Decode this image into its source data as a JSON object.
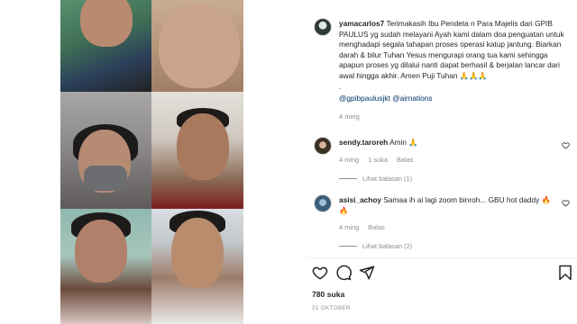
{
  "post": {
    "username": "yamacarlos7",
    "caption": "Terimakasih Ibu Pendeta n Para Majelis dari GPIB PAULUS yg sudah melayani Ayah kami dalam doa penguatan untuk menghadapi segala tahapan proses operasi katup jantung. Biarkan darah & bilur Tuhan Yesus mengurapi orang tua kami sehingga apapun proses yg dilalui nanti dapat berhasil & berjalan lancar dari awal hingga akhir. Amen Puji Tuhan 🙏🙏🙏",
    "dot": ".",
    "tags": "@gpibpaulusjkt @airnations",
    "time": "4 ming"
  },
  "comments": [
    {
      "username": "sendy.taroreh",
      "text": "Amin 🙏",
      "time": "4 ming",
      "likes": "1 suka",
      "reply_label": "Balas",
      "view_replies": "Lihat balasan (1)"
    },
    {
      "username": "asisi_achoy",
      "text": "Samaa ih ai lagi zoom binroh... GBU hot daddy 🔥🔥",
      "time": "4 ming",
      "reply_label": "Balas",
      "view_replies": "Lihat balasan (2)"
    }
  ],
  "footer": {
    "likes": "780 suka",
    "date": "21 OKTOBER"
  },
  "icons": {
    "like": "heart-icon",
    "comment": "comment-icon",
    "share": "share-icon",
    "save": "bookmark-icon"
  },
  "colors": {
    "text": "#262626",
    "muted": "#8e8e8e",
    "link": "#00376b"
  }
}
